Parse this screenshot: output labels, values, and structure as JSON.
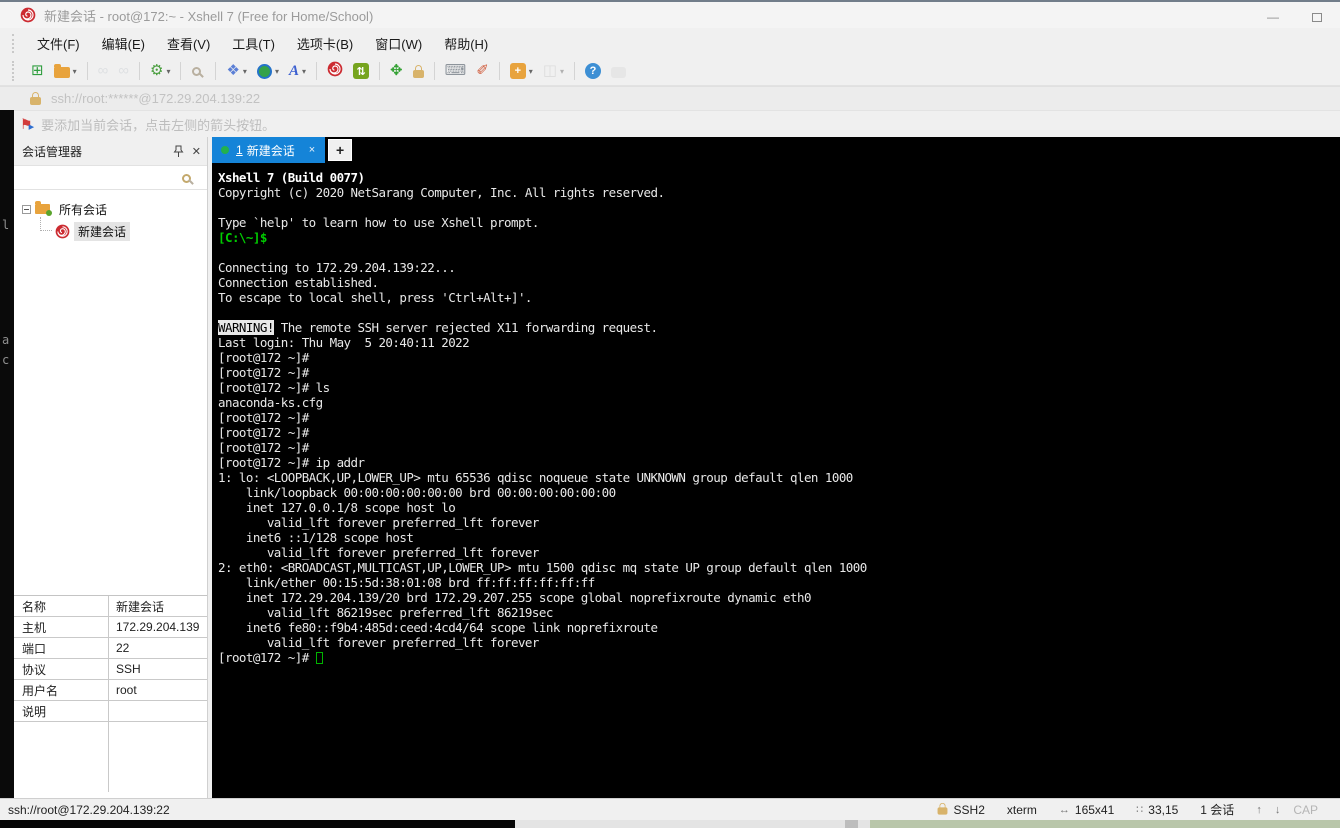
{
  "window": {
    "title": "新建会话 - root@172:~ - Xshell 7 (Free for Home/School)",
    "minimize_glyph": "—"
  },
  "icons": {
    "close": "✕",
    "search_hint": "",
    "flag": "⚑",
    "flag_arrow": "▸"
  },
  "menubar": {
    "items": [
      "文件(F)",
      "编辑(E)",
      "查看(V)",
      "工具(T)",
      "选项卡(B)",
      "窗口(W)",
      "帮助(H)"
    ]
  },
  "toolbar": {
    "icons": [
      {
        "name": "new-session-icon",
        "type": "glyph",
        "glyph": "⊞",
        "color": "#2f9e3f"
      },
      {
        "name": "open-session-icon",
        "type": "folder",
        "dd": true
      },
      {
        "name": "disconnect-icon",
        "type": "glyph",
        "glyph": "∞",
        "color": "#c9ced3",
        "dim": true,
        "sep": true
      },
      {
        "name": "reconnect-icon",
        "type": "glyph",
        "glyph": "∞",
        "color": "#c9ced3",
        "dim": true
      },
      {
        "name": "session-properties-icon",
        "type": "glyph",
        "glyph": "⚙",
        "color": "#4a9e3f",
        "dd": true,
        "sep": true
      },
      {
        "name": "find-icon",
        "type": "mag",
        "sep": true
      },
      {
        "name": "arrange-icon",
        "type": "glyph",
        "glyph": "❖",
        "color": "#5b7fd6",
        "dd": true,
        "sep": true
      },
      {
        "name": "web-browser-icon",
        "type": "globe",
        "dd": true
      },
      {
        "name": "font-icon",
        "type": "glyph",
        "glyph": "A",
        "color": "#3b5fd0",
        "italic": true,
        "dd": true
      },
      {
        "name": "xshell-icon",
        "type": "swirl",
        "sep": true
      },
      {
        "name": "xftp-icon",
        "type": "box",
        "glyph": "⇅",
        "bg": "#76a41e"
      },
      {
        "name": "fullscreen-icon",
        "type": "glyph",
        "glyph": "✥",
        "color": "#33a133",
        "sep": true
      },
      {
        "name": "lock-icon",
        "type": "lock"
      },
      {
        "name": "keyboard-icon",
        "type": "glyph",
        "glyph": "⌨",
        "color": "#8d949b",
        "sep": true
      },
      {
        "name": "highlighter-icon",
        "type": "glyph",
        "glyph": "✐",
        "color": "#d05a3a"
      },
      {
        "name": "add-folder-icon",
        "type": "box",
        "glyph": "+",
        "bg": "#e8a33d",
        "dd": true,
        "sep": true
      },
      {
        "name": "layout-icon",
        "type": "glyph",
        "glyph": "◫",
        "color": "#c6c6c6",
        "dd": true,
        "dim": true
      },
      {
        "name": "help-icon",
        "type": "box",
        "glyph": "?",
        "bg": "#3d8fd4",
        "round": true,
        "sep": true
      },
      {
        "name": "chat-icon",
        "type": "bubble",
        "dim": true
      }
    ]
  },
  "addressbar": {
    "url": "ssh://root:******@172.29.204.139:22"
  },
  "hintbar": {
    "text": "要添加当前会话，点击左侧的箭头按钮。"
  },
  "session_manager": {
    "title": "会话管理器",
    "search_placeholder": "",
    "tree_root_label": "所有会话",
    "tree_child_label": "新建会话"
  },
  "properties": {
    "rows": [
      {
        "label": "名称",
        "value": "新建会话"
      },
      {
        "label": "主机",
        "value": "172.29.204.139"
      },
      {
        "label": "端口",
        "value": "22"
      },
      {
        "label": "协议",
        "value": "SSH"
      },
      {
        "label": "用户名",
        "value": "root"
      },
      {
        "label": "说明",
        "value": ""
      }
    ]
  },
  "tabbar": {
    "active_num": "1",
    "active_name": "新建会话",
    "close_glyph": "×",
    "new_tab_glyph": "+"
  },
  "terminal": {
    "lines": [
      [
        {
          "t": "Xshell 7 (Build 0077)",
          "c": "b"
        }
      ],
      [
        {
          "t": "Copyright (c) 2020 NetSarang Computer, Inc. All rights reserved.",
          "c": ""
        }
      ],
      [],
      [
        {
          "t": "Type `help' to learn how to use Xshell prompt.",
          "c": ""
        }
      ],
      [
        {
          "t": "[C:\\~]$",
          "c": "g"
        }
      ],
      [],
      [
        {
          "t": "Connecting to 172.29.204.139:22...",
          "c": ""
        }
      ],
      [
        {
          "t": "Connection established.",
          "c": ""
        }
      ],
      [
        {
          "t": "To escape to local shell, press 'Ctrl+Alt+]'.",
          "c": ""
        }
      ],
      [],
      [
        {
          "t": "WARNING!",
          "c": "inv"
        },
        {
          "t": " The remote SSH server rejected X11 forwarding request.",
          "c": ""
        }
      ],
      [
        {
          "t": "Last login: Thu May  5 20:40:11 2022",
          "c": ""
        }
      ],
      [
        {
          "t": "[root@172 ~]#",
          "c": ""
        }
      ],
      [
        {
          "t": "[root@172 ~]#",
          "c": ""
        }
      ],
      [
        {
          "t": "[root@172 ~]# ls",
          "c": ""
        }
      ],
      [
        {
          "t": "anaconda-ks.cfg",
          "c": ""
        }
      ],
      [
        {
          "t": "[root@172 ~]#",
          "c": ""
        }
      ],
      [
        {
          "t": "[root@172 ~]#",
          "c": ""
        }
      ],
      [
        {
          "t": "[root@172 ~]#",
          "c": ""
        }
      ],
      [
        {
          "t": "[root@172 ~]# ip addr",
          "c": ""
        }
      ],
      [
        {
          "t": "1: lo: <LOOPBACK,UP,LOWER_UP> mtu 65536 qdisc noqueue state UNKNOWN group default qlen 1000",
          "c": ""
        }
      ],
      [
        {
          "t": "    link/loopback 00:00:00:00:00:00 brd 00:00:00:00:00:00",
          "c": ""
        }
      ],
      [
        {
          "t": "    inet 127.0.0.1/8 scope host lo",
          "c": ""
        }
      ],
      [
        {
          "t": "       valid_lft forever preferred_lft forever",
          "c": ""
        }
      ],
      [
        {
          "t": "    inet6 ::1/128 scope host",
          "c": ""
        }
      ],
      [
        {
          "t": "       valid_lft forever preferred_lft forever",
          "c": ""
        }
      ],
      [
        {
          "t": "2: eth0: <BROADCAST,MULTICAST,UP,LOWER_UP> mtu 1500 qdisc mq state UP group default qlen 1000",
          "c": ""
        }
      ],
      [
        {
          "t": "    link/ether 00:15:5d:38:01:08 brd ff:ff:ff:ff:ff:ff",
          "c": ""
        }
      ],
      [
        {
          "t": "    inet 172.29.204.139/20 brd 172.29.207.255 scope global noprefixroute dynamic eth0",
          "c": ""
        }
      ],
      [
        {
          "t": "       valid_lft 86219sec preferred_lft 86219sec",
          "c": ""
        }
      ],
      [
        {
          "t": "    inet6 fe80::f9b4:485d:ceed:4cd4/64 scope link noprefixroute",
          "c": ""
        }
      ],
      [
        {
          "t": "       valid_lft forever preferred_lft forever",
          "c": ""
        }
      ],
      [
        {
          "t": "[root@172 ~]# ",
          "c": ""
        },
        {
          "t": "",
          "c": "cur"
        }
      ]
    ]
  },
  "statusbar": {
    "left": "ssh://root@172.29.204.139:22",
    "right": [
      {
        "name": "protocol",
        "icon": "lock",
        "label": "SSH2"
      },
      {
        "name": "terminal-type",
        "label": "xterm"
      },
      {
        "name": "terminal-size",
        "glyph": "↔",
        "label": "165x41"
      },
      {
        "name": "cursor-position",
        "glyph": "∷",
        "label": "33,15"
      },
      {
        "name": "session-count",
        "label": "1 会话"
      },
      {
        "name": "scroll-up",
        "glyph": "↑",
        "arrow": true
      },
      {
        "name": "scroll-down",
        "glyph": "↓",
        "arrow": true
      },
      {
        "name": "caps-indicator",
        "label": "CAP",
        "dim": true
      }
    ]
  },
  "edge_text": {
    "letters": [
      "l",
      "a",
      "c"
    ]
  },
  "colors": {
    "accent_blue": "#1584d8",
    "brand_red": "#cc2b31",
    "terminal_green": "#00cc00",
    "tab_dot_green": "#23b14d",
    "terminal_bg": "#000000"
  }
}
